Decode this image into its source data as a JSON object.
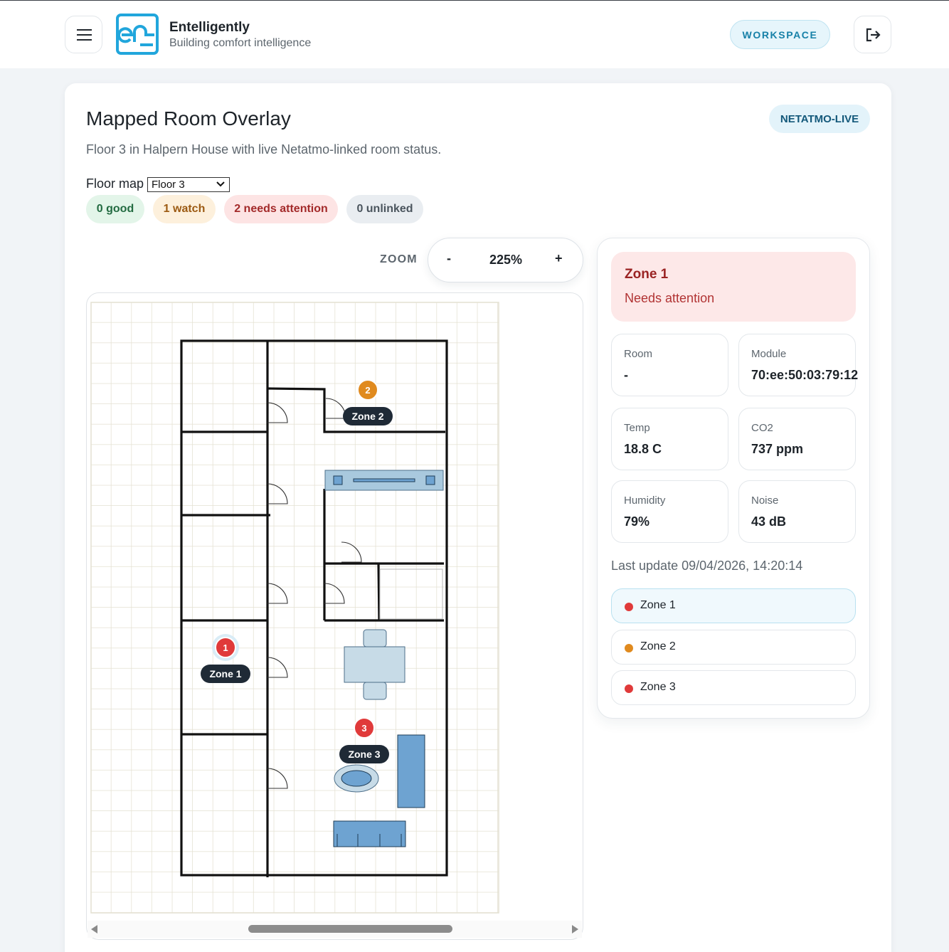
{
  "header": {
    "brand_name": "Entelligently",
    "brand_tagline": "Building comfort intelligence",
    "workspace_label": "WORKSPACE",
    "icons": {
      "menu": "hamburger-menu-icon",
      "logo": "entelligently-logo",
      "logout": "logout-icon"
    }
  },
  "page": {
    "title": "Mapped Room Overlay",
    "subtitle": "Floor 3 in Halpern House with live Netatmo-linked room status.",
    "source_badge": "NETATMO-LIVE",
    "floor_label": "Floor map",
    "floor_selected": "Floor 3"
  },
  "status_counts": {
    "good": "0 good",
    "watch": "1 watch",
    "needs_attention": "2 needs attention",
    "unlinked": "0 unlinked"
  },
  "zoom": {
    "label": "ZOOM",
    "minus": "-",
    "value": "225%",
    "plus": "+"
  },
  "map": {
    "markers": [
      {
        "number": "1",
        "label": "Zone 1",
        "status": "needs attention",
        "color": "#e03a3a"
      },
      {
        "number": "2",
        "label": "Zone 2",
        "status": "watch",
        "color": "#e08a1e"
      },
      {
        "number": "3",
        "label": "Zone 3",
        "status": "needs attention",
        "color": "#e03a3a"
      }
    ]
  },
  "detail": {
    "zone_name": "Zone 1",
    "zone_status": "Needs attention",
    "stats": {
      "room_label": "Room",
      "room_value": "-",
      "module_label": "Module",
      "module_value": "70:ee:50:03:79:12",
      "temp_label": "Temp",
      "temp_value": "18.8 C",
      "co2_label": "CO2",
      "co2_value": "737 ppm",
      "humidity_label": "Humidity",
      "humidity_value": "79%",
      "noise_label": "Noise",
      "noise_value": "43 dB"
    },
    "last_update": "Last update 09/04/2026, 14:20:14"
  },
  "zone_list": [
    {
      "name": "Zone 1",
      "color": "#e03a3a",
      "selected": true
    },
    {
      "name": "Zone 2",
      "color": "#e08a1e",
      "selected": false
    },
    {
      "name": "Zone 3",
      "color": "#e03a3a",
      "selected": false
    }
  ],
  "colors": {
    "accent": "#1781a8",
    "attention": "#e03a3a",
    "watch": "#e08a1e",
    "good": "#236b41"
  }
}
